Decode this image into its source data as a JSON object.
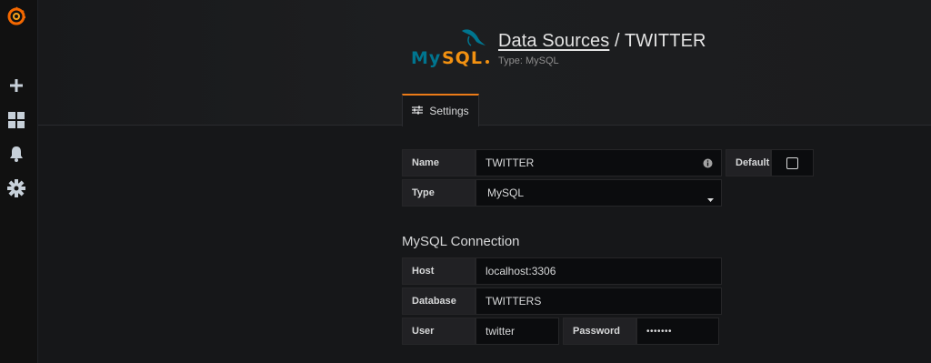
{
  "sidebar": {
    "items": [
      {
        "icon": "grafana-logo-icon"
      },
      {
        "icon": "plus-icon"
      },
      {
        "icon": "dashboards-icon"
      },
      {
        "icon": "bell-icon"
      },
      {
        "icon": "gear-icon"
      }
    ]
  },
  "header": {
    "logo_text": "MySQL",
    "breadcrumb": "Data Sources",
    "separator": " / ",
    "title": "TWITTER",
    "subtitle": "Type: MySQL"
  },
  "tabs": [
    {
      "label": "Settings",
      "active": true
    }
  ],
  "settings": {
    "name_label": "Name",
    "name_value": "TWITTER",
    "default_label": "Default",
    "default_checked": false,
    "type_label": "Type",
    "type_value": "MySQL"
  },
  "connection": {
    "title": "MySQL Connection",
    "host_label": "Host",
    "host_value": "localhost:3306",
    "database_label": "Database",
    "database_value": "TWITTERS",
    "user_label": "User",
    "user_value": "twitter",
    "password_label": "Password",
    "password_value": "•••••••"
  },
  "colors": {
    "accent": "#eb7b18",
    "mysql_blue": "#00758f",
    "mysql_orange": "#f29111"
  }
}
